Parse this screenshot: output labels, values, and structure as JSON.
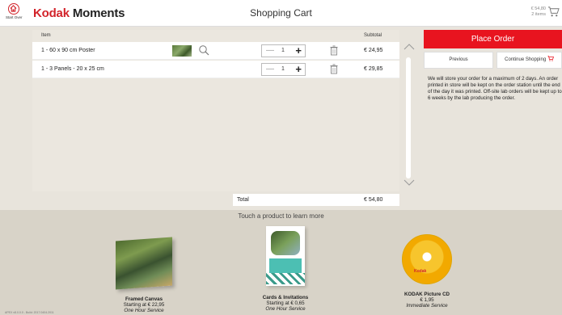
{
  "header": {
    "start_over": "Start Over",
    "brand_kodak": "Kodak",
    "brand_moments": "Moments",
    "title": "Shopping Cart",
    "cart_total": "€ 54,80",
    "cart_items": "2 items"
  },
  "table": {
    "col_item": "Item",
    "col_subtotal": "Subtotal",
    "rows": [
      {
        "name": "1 - 60 x 90 cm Poster",
        "qty": "1",
        "price": "€ 24,95",
        "has_thumb": true
      },
      {
        "name": "1 - 3 Panels - 20 x 25 cm",
        "qty": "1",
        "price": "€ 29,85",
        "has_thumb": false
      }
    ],
    "total_label": "Total",
    "total_value": "€ 54,80"
  },
  "actions": {
    "place_order": "Place Order",
    "previous": "Previous",
    "continue_shopping": "Continue Shopping"
  },
  "info_text": "We will store your order for a maximum of 2 days. An order printed in store will be kept on the order station until the end of the day it was printed. Off-site lab orders will be kept up to 6 weeks by the lab producing the order.",
  "products": {
    "hint": "Touch a product to learn more",
    "items": [
      {
        "name": "Framed Canvas",
        "price": "Starting at € 22,95",
        "service": "One Hour Service"
      },
      {
        "name": "Cards & Invitations",
        "price": "Starting at € 0,65",
        "service": "One Hour Service"
      },
      {
        "name": "KODAK Picture CD",
        "price": "€ 1,95",
        "service": "Immediate Service"
      }
    ]
  },
  "version": "APEX v8.0.0.0 - Build: 2017.0404.2011",
  "colors": {
    "accent": "#e8141f",
    "brand_red": "#d2232a"
  }
}
